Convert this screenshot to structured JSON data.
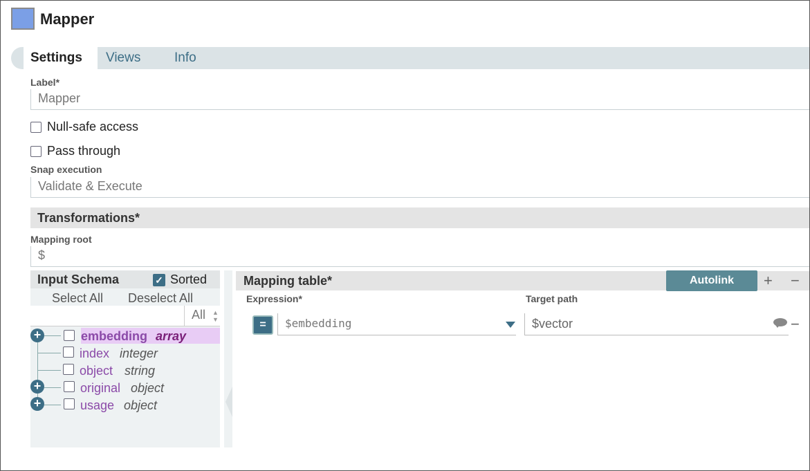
{
  "header": {
    "title": "Mapper",
    "icon": "mapper-snap-icon"
  },
  "tabs": [
    {
      "label": "Settings"
    },
    {
      "label": "Views"
    },
    {
      "label": "Info"
    }
  ],
  "settings": {
    "label_field": {
      "label": "Label*",
      "value": "Mapper"
    },
    "null_safe": {
      "label": "Null-safe access",
      "checked": false
    },
    "pass_through": {
      "label": "Pass through",
      "checked": false
    },
    "snap_execution": {
      "label": "Snap execution",
      "value": "Validate & Execute"
    },
    "transformations": {
      "label": "Transformations*"
    },
    "mapping_root": {
      "label": "Mapping root",
      "value": "$"
    }
  },
  "input_schema": {
    "title": "Input Schema",
    "sorted_label": "Sorted",
    "sorted_checked": true,
    "select_all": "Select All",
    "deselect_all": "Deselect All",
    "filter_option": "All",
    "rows": [
      {
        "name": "embedding",
        "type": "array",
        "expandable": true,
        "highlighted": true
      },
      {
        "name": "index",
        "type": "integer",
        "expandable": false
      },
      {
        "name": "object",
        "type": "string",
        "expandable": false
      },
      {
        "name": "original",
        "type": "object",
        "expandable": true
      },
      {
        "name": "usage",
        "type": "object",
        "expandable": true
      }
    ]
  },
  "mapping_table": {
    "title": "Mapping table*",
    "autolink": "Autolink",
    "add": "+",
    "remove": "−",
    "expression_header": "Expression*",
    "target_header": "Target path",
    "rows": [
      {
        "operator": "=",
        "expression": "$embedding",
        "target": "$vector",
        "remove": "−"
      }
    ]
  },
  "colors": {
    "accent": "#3d6e86",
    "snap_icon": "#7b9fe6",
    "autolink_bg": "#5b8a96",
    "highlight": "#e8ccf5"
  }
}
